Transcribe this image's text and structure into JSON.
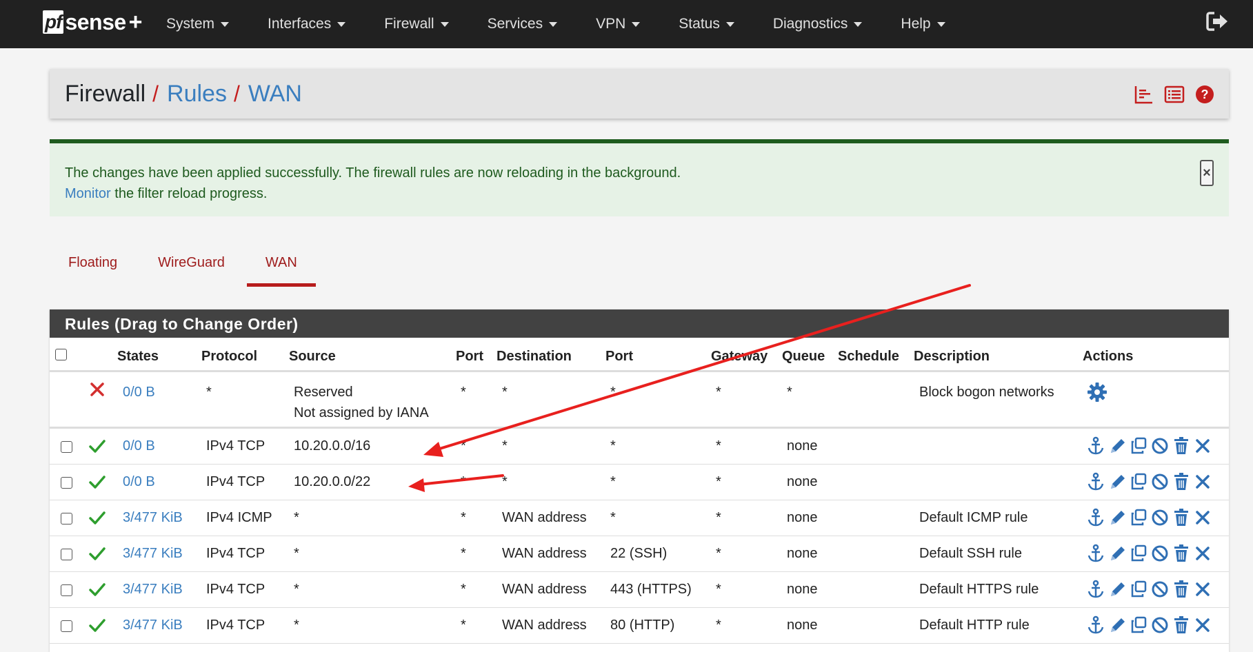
{
  "navbar": {
    "logo": {
      "pf": "pf",
      "sense": "sense",
      "plus": "+"
    },
    "menu": [
      "System",
      "Interfaces",
      "Firewall",
      "Services",
      "VPN",
      "Status",
      "Diagnostics",
      "Help"
    ]
  },
  "breadcrumb": {
    "first": "Firewall",
    "second": "Rules",
    "third": "WAN",
    "separator": "/"
  },
  "alert": {
    "message": "The changes have been applied successfully. The firewall rules are now reloading in the background.",
    "link_text": "Monitor",
    "link_suffix": " the filter reload progress.",
    "close": "×"
  },
  "tabs": [
    {
      "label": "Floating",
      "active": false
    },
    {
      "label": "WireGuard",
      "active": false
    },
    {
      "label": "WAN",
      "active": true
    }
  ],
  "rules": {
    "title": "Rules (Drag to Change Order)",
    "columns": [
      "States",
      "Protocol",
      "Source",
      "Port",
      "Destination",
      "Port",
      "Gateway",
      "Queue",
      "Schedule",
      "Description",
      "Actions"
    ],
    "rows": [
      {
        "status": "block",
        "states": "0/0 B",
        "protocol": "*",
        "source": "Reserved",
        "source2": "Not assigned by IANA",
        "sport": "*",
        "destination": "*",
        "dport": "*",
        "gateway": "*",
        "queue": "*",
        "schedule": "",
        "description": "Block bogon networks",
        "has_checkbox": false
      },
      {
        "status": "pass",
        "states": "0/0 B",
        "protocol": "IPv4 TCP",
        "source": "10.20.0.0/16",
        "sport": "*",
        "destination": "*",
        "dport": "*",
        "gateway": "*",
        "queue": "none",
        "schedule": "",
        "description": "",
        "has_checkbox": true
      },
      {
        "status": "pass",
        "states": "0/0 B",
        "protocol": "IPv4 TCP",
        "source": "10.20.0.0/22",
        "sport": "*",
        "destination": "*",
        "dport": "*",
        "gateway": "*",
        "queue": "none",
        "schedule": "",
        "description": "",
        "has_checkbox": true
      },
      {
        "status": "pass",
        "states": "3/477 KiB",
        "protocol": "IPv4 ICMP",
        "source": "*",
        "sport": "*",
        "destination": "WAN address",
        "dport": "*",
        "gateway": "*",
        "queue": "none",
        "schedule": "",
        "description": "Default ICMP rule",
        "has_checkbox": true
      },
      {
        "status": "pass",
        "states": "3/477 KiB",
        "protocol": "IPv4 TCP",
        "source": "*",
        "sport": "*",
        "destination": "WAN address",
        "dport": "22 (SSH)",
        "gateway": "*",
        "queue": "none",
        "schedule": "",
        "description": "Default SSH rule",
        "has_checkbox": true
      },
      {
        "status": "pass",
        "states": "3/477 KiB",
        "protocol": "IPv4 TCP",
        "source": "*",
        "sport": "*",
        "destination": "WAN address",
        "dport": "443 (HTTPS)",
        "gateway": "*",
        "queue": "none",
        "schedule": "",
        "description": "Default HTTPS rule",
        "has_checkbox": true
      },
      {
        "status": "pass",
        "states": "3/477 KiB",
        "protocol": "IPv4 TCP",
        "source": "*",
        "sport": "*",
        "destination": "WAN address",
        "dport": "80 (HTTP)",
        "gateway": "*",
        "queue": "none",
        "schedule": "",
        "description": "Default HTTP rule",
        "has_checkbox": true
      }
    ]
  },
  "icons": {
    "logout": "logout-icon",
    "crumb": [
      "chart-icon",
      "list-icon",
      "help-icon"
    ],
    "actions": [
      "anchor-icon",
      "pencil-icon",
      "copy-icon",
      "disable-icon",
      "trash-icon",
      "delete-icon"
    ]
  },
  "colors": {
    "navbar": "#212121",
    "link": "#3a7ebf",
    "accent_red": "#b71c1c",
    "pass_green": "#2e9e2e",
    "block_red": "#d32f2f",
    "action_blue": "#2f6fb4"
  }
}
